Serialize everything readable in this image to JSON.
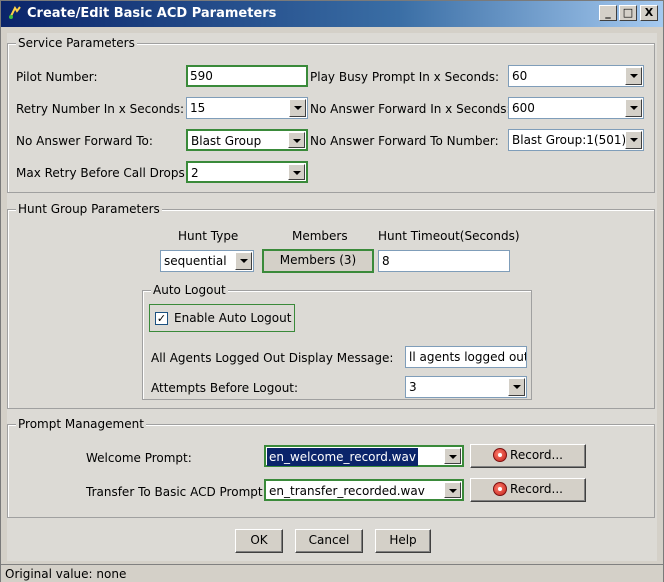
{
  "window": {
    "title": "Create/Edit Basic ACD Parameters",
    "minimize": "_",
    "maximize": "□",
    "close": "X"
  },
  "service": {
    "title": "Service Parameters",
    "pilot_number_label": "Pilot Number:",
    "pilot_number_value": "590",
    "play_busy_label": "Play Busy Prompt In x Seconds:",
    "play_busy_value": "60",
    "retry_number_label": "Retry Number In x Seconds:",
    "retry_number_value": "15",
    "no_answer_secs_label": "No Answer Forward In x Seconds:",
    "no_answer_secs_value": "600",
    "no_answer_to_label": "No Answer Forward To:",
    "no_answer_to_value": "Blast Group",
    "no_answer_number_label": "No Answer Forward To Number:",
    "no_answer_number_value": "Blast Group:1(501)",
    "max_retry_label": "Max Retry Before Call Drops:",
    "max_retry_value": "2"
  },
  "hunt": {
    "title": "Hunt Group Parameters",
    "hunt_type_header": "Hunt Type",
    "members_header": "Members",
    "timeout_header": "Hunt Timeout(Seconds)",
    "hunt_type_value": "sequential",
    "members_button": "Members (3)",
    "timeout_value": "8",
    "auto_logout": {
      "title": "Auto Logout",
      "enable_label": "Enable Auto Logout",
      "enable_checked": "✓",
      "message_label": "All Agents Logged Out Display Message:",
      "message_value": "ll agents logged out",
      "attempts_label": "Attempts Before Logout:",
      "attempts_value": "3"
    }
  },
  "prompt": {
    "title": "Prompt Management",
    "welcome_label": "Welcome Prompt:",
    "welcome_value": "en_welcome_record.wav",
    "transfer_label": "Transfer To Basic ACD Prompt:",
    "transfer_value": "en_transfer_recorded.wav",
    "record_button": "Record..."
  },
  "footer": {
    "ok": "OK",
    "cancel": "Cancel",
    "help": "Help"
  },
  "status": {
    "text": "Original value: none"
  }
}
